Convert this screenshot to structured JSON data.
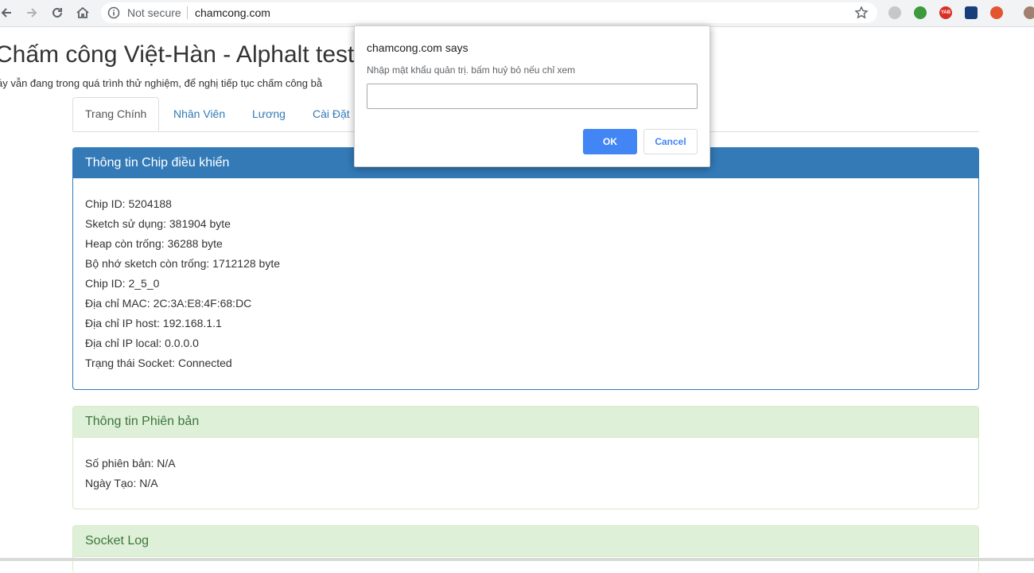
{
  "browser": {
    "security_label": "Not secure",
    "url": "chamcong.com",
    "icons": [
      "back-icon",
      "forward-icon",
      "reload-icon",
      "home-icon",
      "info-icon",
      "star-icon"
    ],
    "extension_badge": "YAB"
  },
  "page": {
    "title": "Chấm công Việt-Hàn - Alphalt test",
    "subtitle": "áy vẫn đang trong quá trình thử nghiệm, để nghị tiếp tục chấm công bằ",
    "tabs": [
      {
        "label": "Trang Chính",
        "active": true
      },
      {
        "label": "Nhân Viên",
        "active": false
      },
      {
        "label": "Lương",
        "active": false
      },
      {
        "label": "Cài Đặt",
        "active": false
      }
    ]
  },
  "panels": {
    "chip": {
      "heading": "Thông tin Chip điều khiển",
      "rows": [
        "Chip ID: 5204188",
        "Sketch sử dụng: 381904 byte",
        "Heap còn trống: 36288 byte",
        "Bộ nhớ sketch còn trống: 1712128 byte",
        "Chip ID: 2_5_0",
        "Địa chỉ MAC: 2C:3A:E8:4F:68:DC",
        "Địa chỉ IP host: 192.168.1.1",
        "Địa chỉ IP local: 0.0.0.0",
        "Trạng thái Socket: Connected"
      ]
    },
    "version": {
      "heading": "Thông tin Phiên bản",
      "rows": [
        "Số phiên bản: N/A",
        "Ngày Tạo: N/A"
      ]
    },
    "socket": {
      "heading": "Socket Log"
    }
  },
  "dialog": {
    "title": "chamcong.com says",
    "message": "Nhập mật khẩu quản trị. bấm huỷ bỏ nếu chỉ xem",
    "input_value": "",
    "ok_label": "OK",
    "cancel_label": "Cancel"
  },
  "colors": {
    "primary": "#337ab7",
    "success_bg": "#dff0d8",
    "success_text": "#3c763d",
    "dialog_ok": "#4285f4"
  }
}
